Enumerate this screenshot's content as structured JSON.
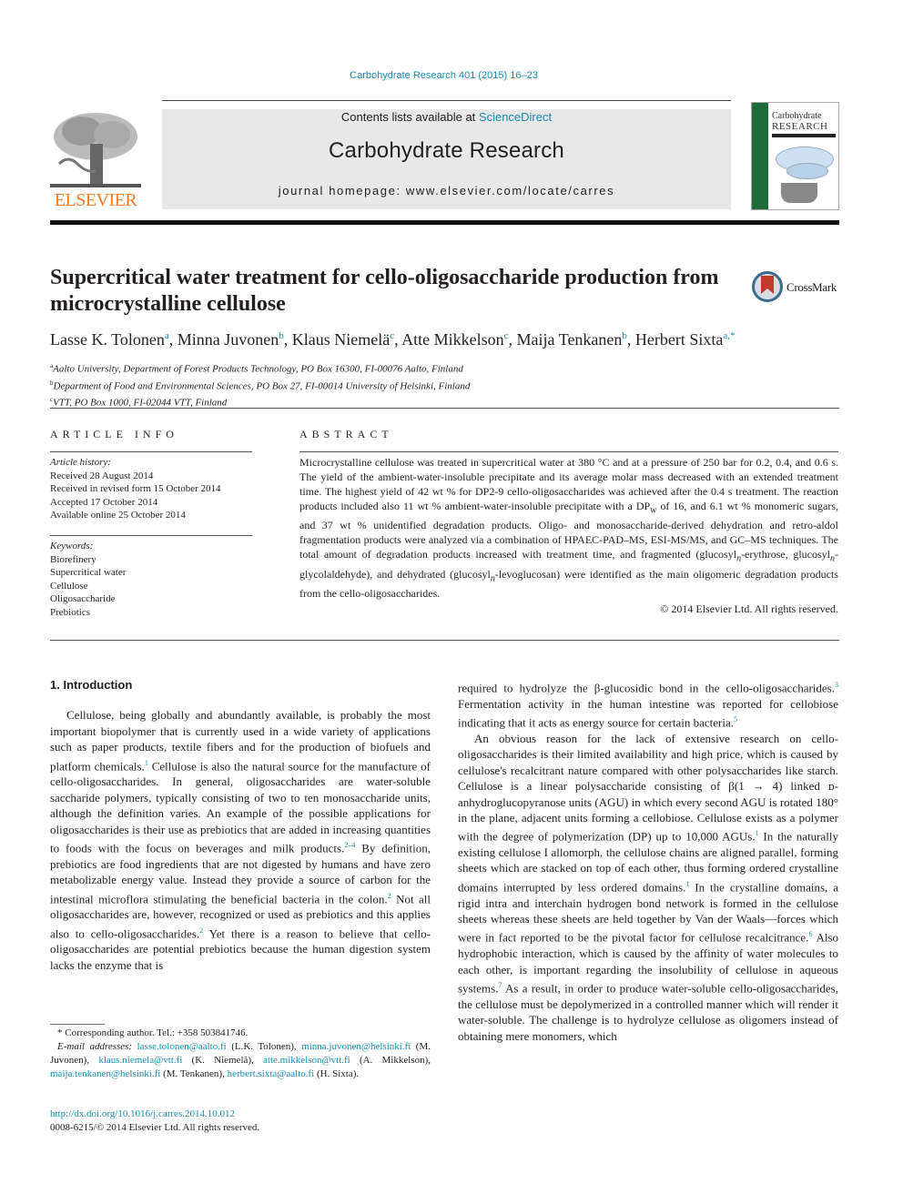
{
  "header": {
    "citation": "Carbohydrate Research 401 (2015) 16–23",
    "contents_prefix": "Contents lists available at ",
    "contents_link": "ScienceDirect",
    "journal_title": "Carbohydrate Research",
    "homepage": "journal homepage: www.elsevier.com/locate/carres",
    "publisher_logo": "ELSEVIER",
    "cover_title_1": "Carbohydrate",
    "cover_title_2": "RESEARCH"
  },
  "article": {
    "title": "Supercritical water treatment for cello-oligosaccharide production from microcrystalline cellulose",
    "crossmark": "CrossMark",
    "authors": [
      {
        "name": "Lasse K. Tolonen",
        "aff": "a"
      },
      {
        "name": "Minna Juvonen",
        "aff": "b"
      },
      {
        "name": "Klaus Niemelä",
        "aff": "c"
      },
      {
        "name": "Atte Mikkelson",
        "aff": "c"
      },
      {
        "name": "Maija Tenkanen",
        "aff": "b"
      },
      {
        "name": "Herbert Sixta",
        "aff": "a,*"
      }
    ],
    "affiliations": [
      {
        "key": "a",
        "text": "Aalto University, Department of Forest Products Technology, PO Box 16300, FI-00076 Aalto, Finland"
      },
      {
        "key": "b",
        "text": "Department of Food and Environmental Sciences, PO Box 27, FI-00014 University of Helsinki, Finland"
      },
      {
        "key": "c",
        "text": "VTT, PO Box 1000, FI-02044 VTT, Finland"
      }
    ]
  },
  "article_info": {
    "heading": "ARTICLE INFO",
    "history_label": "Article history:",
    "history": [
      "Received 28 August 2014",
      "Received in revised form 15 October 2014",
      "Accepted 17 October 2014",
      "Available online 25 October 2014"
    ],
    "keywords_label": "Keywords:",
    "keywords": [
      "Biorefinery",
      "Supercritical water",
      "Cellulose",
      "Oligosaccharide",
      "Prebiotics"
    ]
  },
  "abstract": {
    "heading": "ABSTRACT",
    "text_1": "Microcrystalline cellulose was treated in supercritical water at 380 °C and at a pressure of 250 bar for 0.2, 0.4, and 0.6 s. The yield of the ambient-water-insoluble precipitate and its average molar mass decreased with an extended treatment time. The highest yield of 42 wt % for DP2-9 cello-oligosaccharides was achieved after the 0.4 s treatment. The reaction products included also 11 wt % ambient-water-insoluble precipitate with a DP",
    "sub_w": "w",
    "text_2": " of 16, and 6.1 wt % monomeric sugars, and 37 wt % unidentified degradation products. Oligo- and monosaccharide-derived dehydration and retro-aldol fragmentation products were analyzed via a combination of HPAEC-PAD–MS, ESI-MS/MS, and GC–MS techniques. The total amount of degradation products increased with treatment time, and fragmented (glucosyl",
    "sub_n": "n",
    "text_3": "-erythrose, glucosyl",
    "text_4": "-glycolaldehyde), and dehydrated (glucosyl",
    "text_5": "-levoglucosan) were identified as the main oligomeric degradation products from the cello-oligosaccharides.",
    "copyright": "© 2014 Elsevier Ltd. All rights reserved."
  },
  "body": {
    "section_heading": "1. Introduction",
    "left_p1": [
      {
        "t": "Cellulose, being globally and abundantly available, is probably the most important biopolymer that is currently used in a wide variety of applications such as paper products, textile fibers and for the production of biofuels and platform chemicals."
      },
      {
        "ref": "1"
      },
      {
        "t": " Cellulose is also the natural source for the manufacture of cello-oligosaccharides. In general, oligosaccharides are water-soluble saccharide polymers, typically consisting of two to ten monosaccharide units, although the definition varies. An example of the possible applications for oligosaccharides is their use as prebiotics that are added in increasing quantities to foods with the focus on beverages and milk products."
      },
      {
        "ref": "2–4"
      },
      {
        "t": " By definition, prebiotics are food ingredients that are not digested by humans and have zero metabolizable energy value. Instead they provide a source of carbon for the intestinal microflora stimulating the beneficial bacteria in the colon."
      },
      {
        "ref": "2"
      },
      {
        "t": " Not all oligosaccharides are, however, recognized or used as prebiotics and this applies also to cello-oligosaccharides."
      },
      {
        "ref": "2"
      },
      {
        "t": " Yet there is a reason to believe that cello-oligosaccharides are potential prebiotics because the human digestion system lacks the enzyme that is"
      }
    ],
    "right_p1": [
      {
        "t": "required to hydrolyze the β-glucosidic bond in the cello-oligosaccharides."
      },
      {
        "ref": "3"
      },
      {
        "t": " Fermentation activity in the human intestine was reported for cellobiose indicating that it acts as energy source for certain bacteria."
      },
      {
        "ref": "5"
      }
    ],
    "right_p2": [
      {
        "t": "An obvious reason for the lack of extensive research on cello-oligosaccharides is their limited availability and high price, which is caused by cellulose's recalcitrant nature compared with other polysaccharides like starch. Cellulose is a linear polysaccharide consisting of β(1 → 4) linked ᴅ-anhydroglucopyranose units (AGU) in which every second AGU is rotated 180° in the plane, adjacent units forming a cellobiose. Cellulose exists as a polymer with the degree of polymerization (DP) up to 10,000 AGUs."
      },
      {
        "ref": "1"
      },
      {
        "t": " In the naturally existing cellulose I allomorph, the cellulose chains are aligned parallel, forming sheets which are stacked on top of each other, thus forming ordered crystalline domains interrupted by less ordered domains."
      },
      {
        "ref": "1"
      },
      {
        "t": " In the crystalline domains, a rigid intra and interchain hydrogen bond network is formed in the cellulose sheets whereas these sheets are held together by Van der Waals—forces which were in fact reported to be the pivotal factor for cellulose recalcitrance."
      },
      {
        "ref": "6"
      },
      {
        "t": " Also hydrophobic interaction, which is caused by the affinity of water molecules to each other, is important regarding the insolubility of cellulose in aqueous systems."
      },
      {
        "ref": "7"
      },
      {
        "t": " As a result, in order to produce water-soluble cello-oligosaccharides, the cellulose must be depolymerized in a controlled manner which will render it water-soluble. The challenge is to hydrolyze cellulose as oligomers instead of obtaining mere monomers, which"
      }
    ]
  },
  "footnotes": {
    "corresponding": "* Corresponding author. Tel.: +358 503841746.",
    "email_label": "E-mail addresses: ",
    "emails": [
      {
        "email": "lasse.tolonen@aalto.fi",
        "who": " (L.K. Tolonen), "
      },
      {
        "email": "minna.juvonen@helsinki.fi",
        "who": " (M. Juvonen), "
      },
      {
        "email": "klaus.niemela@vtt.fi",
        "who": " (K. Niemelä), "
      },
      {
        "email": "atte.mikkelson@vtt.fi",
        "who": " (A. Mikkelson), "
      },
      {
        "email": "maija.tenkanen@helsinki.fi",
        "who": " (M. Tenkanen), "
      },
      {
        "email": "herbert.sixta@aalto.fi",
        "who": " (H. Sixta)."
      }
    ],
    "doi": "http://dx.doi.org/10.1016/j.carres.2014.10.012",
    "issn": "0008-6215/© 2014 Elsevier Ltd. All rights reserved."
  },
  "colors": {
    "link": "#1a8bb3",
    "elsevier_orange": "#f47b20",
    "banner_bg": "#e8e8e8"
  }
}
